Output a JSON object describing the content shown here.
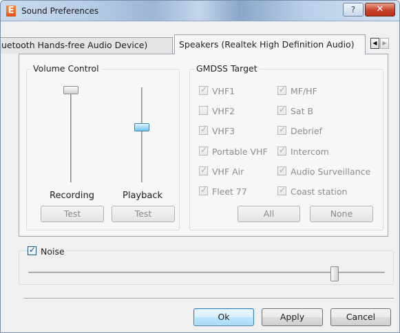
{
  "window": {
    "title": "Sound Preferences",
    "app_icon_letter": "E",
    "help_glyph": "?",
    "close_glyph": "✕"
  },
  "tabs": [
    {
      "label": "uetooth Hands-free Audio Device)",
      "selected": false
    },
    {
      "label": "Speakers (Realtek High Definition Audio)",
      "selected": true
    }
  ],
  "tab_scroll": {
    "left": "◀",
    "right": "▶"
  },
  "volume_control": {
    "title": "Volume Control",
    "recording": {
      "label": "Recording",
      "level": 1.0,
      "test_label": "Test"
    },
    "playback": {
      "label": "Playback",
      "level": 0.58,
      "test_label": "Test"
    }
  },
  "gmdss": {
    "title": "GMDSS Target",
    "items": [
      {
        "label": "VHF1",
        "checked": true
      },
      {
        "label": "MF/HF",
        "checked": true
      },
      {
        "label": "VHF2",
        "checked": false
      },
      {
        "label": "Sat B",
        "checked": true
      },
      {
        "label": "VHF3",
        "checked": true
      },
      {
        "label": "Debrief",
        "checked": true
      },
      {
        "label": "Portable VHF",
        "checked": true
      },
      {
        "label": "Intercom",
        "checked": true
      },
      {
        "label": "VHF Air",
        "checked": true
      },
      {
        "label": "Audio Surveillance",
        "checked": true
      },
      {
        "label": "Fleet 77",
        "checked": true
      },
      {
        "label": "Coast station",
        "checked": true
      }
    ],
    "all_label": "All",
    "none_label": "None"
  },
  "noise": {
    "label": "Noise",
    "checked": true,
    "level": 0.86
  },
  "footer": {
    "ok_label": "Ok",
    "apply_label": "Apply",
    "cancel_label": "Cancel"
  },
  "colors": {
    "accent": "#3c7fb1",
    "close_red": "#c8432b",
    "thumb_blue": "#6ec6ef"
  }
}
